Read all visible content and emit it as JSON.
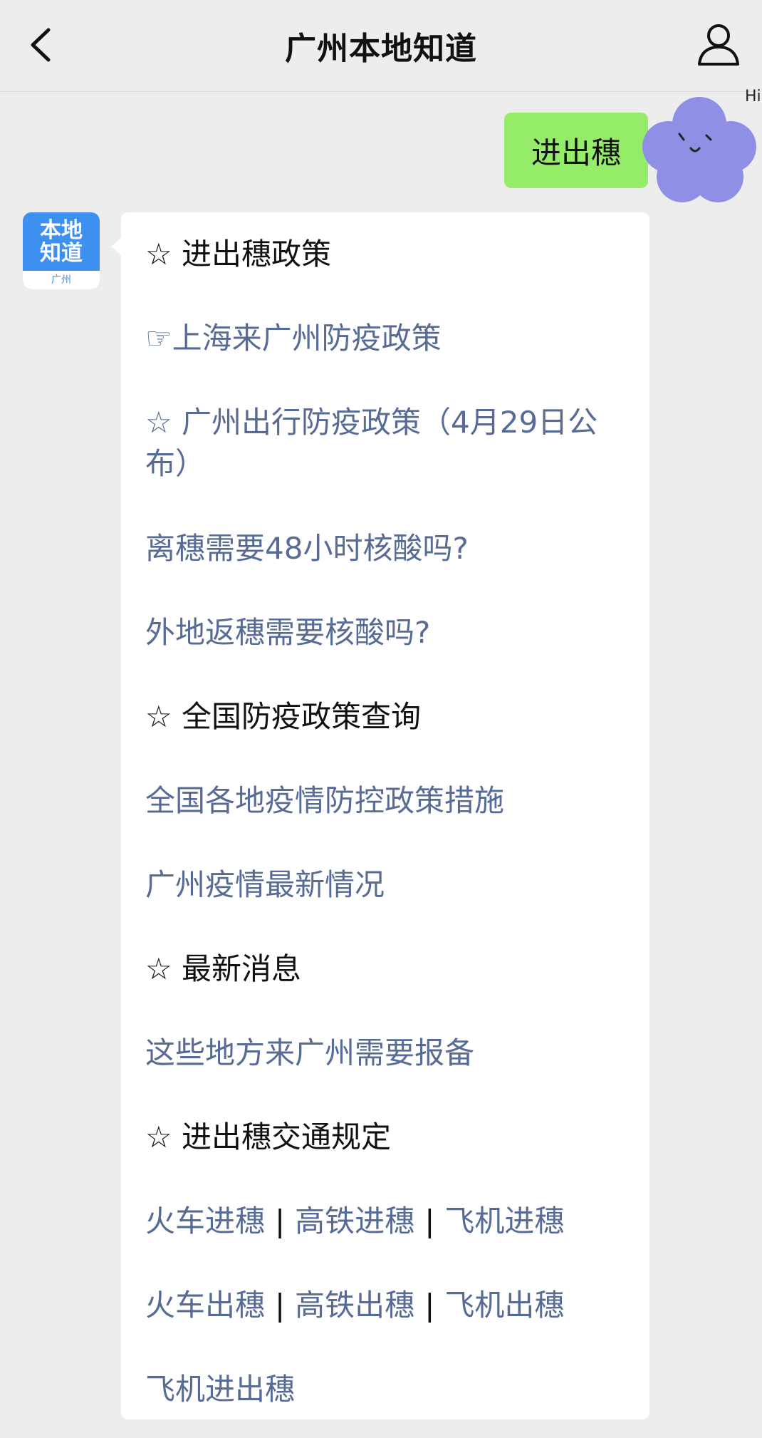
{
  "header": {
    "title": "广州本地知道"
  },
  "chat": {
    "outgoing": {
      "text": "进出穗",
      "avatar_text": "Hi"
    },
    "bot": {
      "avatar_text": "本地知道",
      "avatar_city": "广州",
      "lines": [
        {
          "text": "☆ 进出穗政策",
          "kind": "heading"
        },
        {
          "text": "☞上海来广州防疫政策",
          "kind": "link"
        },
        {
          "text": "☆ 广州出行防疫政策（4月29日公布）",
          "kind": "link"
        },
        {
          "text": "离穗需要48小时核酸吗?",
          "kind": "link"
        },
        {
          "text": "外地返穗需要核酸吗?",
          "kind": "link"
        },
        {
          "text": "☆ 全国防疫政策查询",
          "kind": "heading"
        },
        {
          "text": "全国各地疫情防控政策措施",
          "kind": "link"
        },
        {
          "text": "广州疫情最新情况",
          "kind": "link"
        },
        {
          "text": "☆ 最新消息",
          "kind": "heading"
        },
        {
          "text": "这些地方来广州需要报备",
          "kind": "link"
        },
        {
          "text": "☆ 进出穗交通规定",
          "kind": "heading"
        }
      ],
      "transport_in": [
        "火车进穗",
        "高铁进穗",
        "飞机进穗"
      ],
      "transport_out": [
        "火车出穗",
        "高铁出穗",
        "飞机出穗"
      ],
      "separator": "|",
      "last_line": "飞机进出穗"
    }
  },
  "icons": {
    "back": "chevron-left-icon",
    "user": "user-icon",
    "sticker": "flower-face-sticker"
  }
}
